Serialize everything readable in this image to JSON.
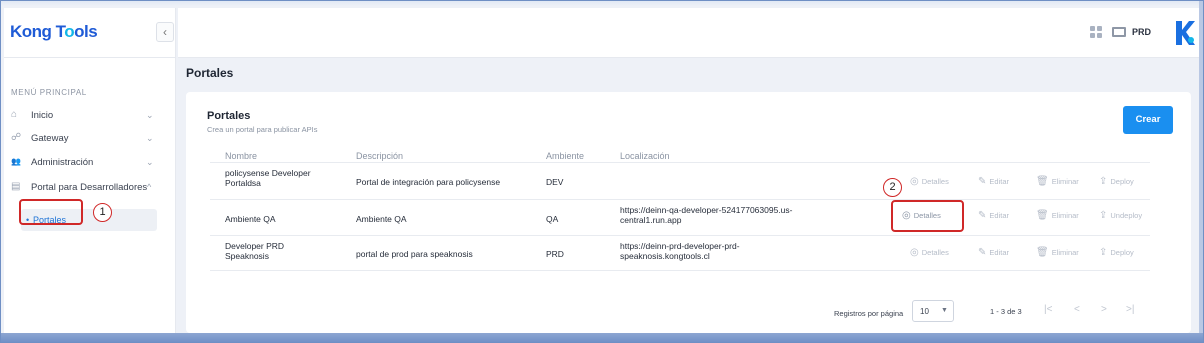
{
  "app": {
    "logo_part1": "Kong T",
    "logo_part2": "o",
    "logo_part3": "ols",
    "collapse_icon": "chevron-left-icon",
    "collapse_glyph": "‹"
  },
  "sidebar": {
    "caption": "MENÚ PRINCIPAL",
    "items": [
      {
        "label": "Inicio",
        "icon": "home-icon",
        "glyph": "⌂",
        "chevron": "⌄"
      },
      {
        "label": "Gateway",
        "icon": "gateway-icon",
        "glyph": "☍",
        "chevron": "⌄"
      },
      {
        "label": "Administración",
        "icon": "users-icon",
        "glyph": "👥",
        "chevron": "⌄"
      },
      {
        "label": "Portal para Desarrolladores",
        "icon": "document-icon",
        "glyph": "▤",
        "chevron": "^"
      }
    ],
    "subitem": {
      "label": "Portales",
      "dot": "•"
    }
  },
  "header": {
    "env_label": "PRD",
    "brand_icon": "kong-k-icon"
  },
  "page": {
    "title": "Portales"
  },
  "card": {
    "title": "Portales",
    "subtitle": "Crea un portal para publicar APIs",
    "create_button": "Crear"
  },
  "table": {
    "columns": [
      "Nombre",
      "Descripción",
      "Ambiente",
      "Localización"
    ],
    "rows": [
      {
        "name_line1": "policysense Developer",
        "name_line2": "Portaldsa",
        "description": "Portal de integración para policysense",
        "environment": "DEV",
        "location_line1": "",
        "location_line2": "",
        "actions": [
          "Detalles",
          "Editar",
          "Eliminar",
          "Deploy"
        ]
      },
      {
        "name_line1": "Ambiente QA",
        "name_line2": "",
        "description": "Ambiente QA",
        "environment": "QA",
        "location_line1": "https://deinn-qa-developer-524177063095.us-",
        "location_line2": "central1.run.app",
        "actions": [
          "Detalles",
          "Editar",
          "Eliminar",
          "Undeploy"
        ]
      },
      {
        "name_line1": "Developer PRD",
        "name_line2": "Speaknosis",
        "description": "portal de prod para speaknosis",
        "environment": "PRD",
        "location_line1": "https://deinn-prd-developer-prd-",
        "location_line2": "speaknosis.kongtools.cl",
        "actions": [
          "Detalles",
          "Editar",
          "Eliminar",
          "Deploy"
        ]
      }
    ],
    "action_glyphs": [
      "◎",
      "✎",
      "🗑",
      "⇪"
    ]
  },
  "pagination": {
    "rows_per_page_label": "Registros por página",
    "rows_per_page_value": "10",
    "range": "1 - 3 de 3",
    "first": "|<",
    "prev": "<",
    "next": ">",
    "last": ">|",
    "caret": "▼"
  },
  "annotations": [
    {
      "number": "1"
    },
    {
      "number": "2"
    }
  ],
  "colors": {
    "accent": "#1a8ff0",
    "annotation": "#d02828",
    "link": "#1e73d6"
  }
}
